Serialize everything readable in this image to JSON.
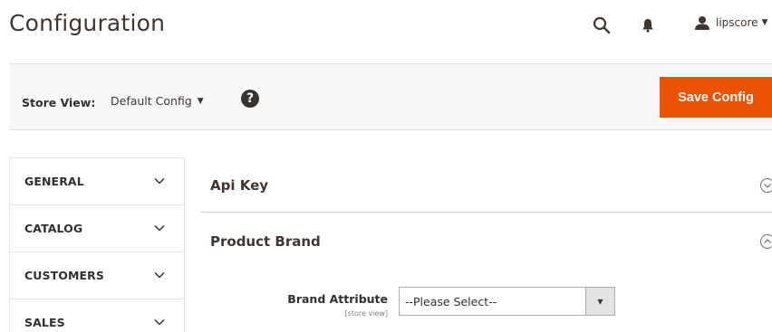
{
  "header": {
    "title": "Configuration",
    "user": {
      "name": "lipscore"
    }
  },
  "icons": {
    "search": "search-icon",
    "notifications": "bell-icon",
    "user": "user-icon",
    "help": "help-icon",
    "chevron": "chevron-down-icon",
    "section_collapsed": "chevron-circle-down-icon",
    "section_expanded": "chevron-circle-up-icon"
  },
  "scope": {
    "label": "Store View:",
    "value": "Default Config",
    "help_glyph": "?"
  },
  "actions": {
    "save_label": "Save Config"
  },
  "colors": {
    "accent": "#eb5202",
    "text": "#41362f"
  },
  "sidebar": {
    "items": [
      {
        "label": "GENERAL"
      },
      {
        "label": "CATALOG"
      },
      {
        "label": "CUSTOMERS"
      },
      {
        "label": "SALES"
      }
    ]
  },
  "sections": {
    "api_key": {
      "title": "Api Key",
      "expanded": false
    },
    "product_brand": {
      "title": "Product Brand",
      "expanded": true
    }
  },
  "fields": {
    "brand_attribute": {
      "label": "Brand Attribute",
      "scope": "[store view]",
      "value": "--Please Select--"
    }
  }
}
